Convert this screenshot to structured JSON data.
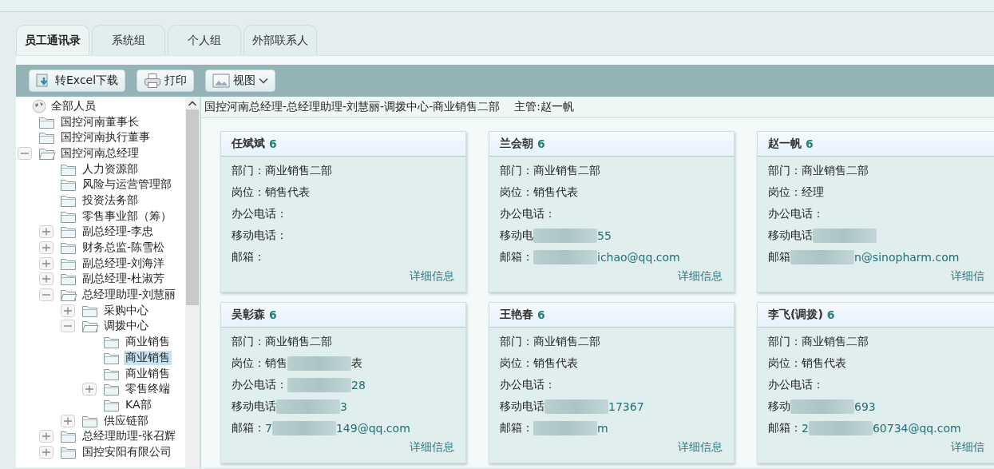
{
  "tabs": [
    {
      "label": "员工通讯录",
      "selected": true
    },
    {
      "label": "系统组",
      "selected": false
    },
    {
      "label": "个人组",
      "selected": false
    },
    {
      "label": "外部联系人",
      "selected": false
    }
  ],
  "toolbar": [
    {
      "kind": "excel",
      "label": "转Excel下载"
    },
    {
      "kind": "print",
      "label": "打印"
    },
    {
      "kind": "view",
      "label": "视图"
    }
  ],
  "tree": {
    "label": "全部人员",
    "selected": false,
    "children": [
      {
        "label": "国控河南董事长",
        "selected": false
      },
      {
        "label": "国控河南执行董事",
        "selected": false
      },
      {
        "label": "国控河南总经理",
        "selected": false,
        "expanded": true,
        "children": [
          {
            "label": "人力资源部",
            "selected": false
          },
          {
            "label": "风险与运营管理部",
            "selected": false
          },
          {
            "label": "投资法务部",
            "selected": false
          },
          {
            "label": "零售事业部（筹）",
            "selected": false
          },
          {
            "label": "副总经理-李忠",
            "selected": false,
            "expanded": false
          },
          {
            "label": "财务总监-陈雪松",
            "selected": false,
            "expanded": false
          },
          {
            "label": "副总经理-刘海洋",
            "selected": false,
            "expanded": false
          },
          {
            "label": "副总经理-杜淑芳",
            "selected": false,
            "expanded": false
          },
          {
            "label": "总经理助理-刘慧丽",
            "selected": false,
            "expanded": true,
            "children": [
              {
                "label": "采购中心",
                "selected": false,
                "expanded": false
              },
              {
                "label": "调拨中心",
                "selected": false,
                "expanded": true,
                "children": [
                  {
                    "label": "商业销售",
                    "selected": false
                  },
                  {
                    "label": "商业销售",
                    "selected": true
                  },
                  {
                    "label": "商业销售",
                    "selected": false
                  },
                  {
                    "label": "零售终端",
                    "selected": false,
                    "expanded": false
                  },
                  {
                    "label": "KA部",
                    "selected": false
                  }
                ]
              },
              {
                "label": "供应链部",
                "selected": false,
                "expanded": false
              }
            ]
          },
          {
            "label": "总经理助理-张召辉",
            "selected": false,
            "expanded": false
          },
          {
            "label": "国控安阳有限公司",
            "selected": false,
            "expanded": false
          }
        ]
      }
    ]
  },
  "breadcrumb": {
    "path": "国控河南总经理-总经理助理-刘慧丽-调拨中心-商业销售二部",
    "manager": "主管:赵一帆"
  },
  "cards": [
    {
      "name": "任斌斌",
      "count": "6",
      "link": "详细信息",
      "fields": [
        [
          {
            "kind": "label",
            "text": "部门：商业销售二部"
          }
        ],
        [
          {
            "kind": "label",
            "text": "岗位：销售代表"
          }
        ],
        [
          {
            "kind": "label",
            "text": "办公电话："
          }
        ],
        [
          {
            "kind": "label",
            "text": "移动电话："
          }
        ],
        [
          {
            "kind": "label",
            "text": "邮箱："
          }
        ]
      ]
    },
    {
      "name": "兰会朝",
      "count": "6",
      "link": "详细信息",
      "fields": [
        [
          {
            "kind": "label",
            "text": "部门：商业销售二部"
          }
        ],
        [
          {
            "kind": "label",
            "text": "岗位：销售代表"
          }
        ],
        [
          {
            "kind": "label",
            "text": "办公电话："
          }
        ],
        [
          {
            "kind": "label",
            "text": "移动电"
          },
          {
            "kind": "mask"
          },
          {
            "kind": "value",
            "text": "55"
          }
        ],
        [
          {
            "kind": "label",
            "text": "邮箱："
          },
          {
            "kind": "mask"
          },
          {
            "kind": "value",
            "text": "ichao@qq.com"
          }
        ]
      ]
    },
    {
      "name": "赵一帆",
      "count": "6",
      "link": "详细信",
      "fields": [
        [
          {
            "kind": "label",
            "text": "部门：商业销售二部"
          }
        ],
        [
          {
            "kind": "label",
            "text": "岗位：经理"
          }
        ],
        [
          {
            "kind": "label",
            "text": "办公电话："
          }
        ],
        [
          {
            "kind": "label",
            "text": "移动电话"
          },
          {
            "kind": "mask"
          }
        ],
        [
          {
            "kind": "label",
            "text": "邮箱"
          },
          {
            "kind": "mask"
          },
          {
            "kind": "value",
            "text": "n@sinopharm.com"
          }
        ]
      ]
    },
    {
      "name": "吴彰森",
      "count": "6",
      "link": "详细信息",
      "fields": [
        [
          {
            "kind": "label",
            "text": "部门：商业销售二部"
          }
        ],
        [
          {
            "kind": "label",
            "text": "岗位：销售"
          },
          {
            "kind": "mask"
          },
          {
            "kind": "label",
            "text": "表"
          }
        ],
        [
          {
            "kind": "label",
            "text": "办公电话："
          },
          {
            "kind": "mask"
          },
          {
            "kind": "value",
            "text": "28"
          }
        ],
        [
          {
            "kind": "label",
            "text": "移动电话"
          },
          {
            "kind": "mask"
          },
          {
            "kind": "value",
            "text": "3"
          }
        ],
        [
          {
            "kind": "label",
            "text": "邮箱："
          },
          {
            "kind": "value",
            "text": "7"
          },
          {
            "kind": "mask"
          },
          {
            "kind": "value",
            "text": "149@qq.com"
          }
        ]
      ]
    },
    {
      "name": "王艳春",
      "count": "6",
      "link": "详细信息",
      "fields": [
        [
          {
            "kind": "label",
            "text": "部门：商业销售二部"
          }
        ],
        [
          {
            "kind": "label",
            "text": "岗位：销售代表"
          }
        ],
        [
          {
            "kind": "label",
            "text": "办公电话："
          }
        ],
        [
          {
            "kind": "label",
            "text": "移动电话"
          },
          {
            "kind": "mask"
          },
          {
            "kind": "value",
            "text": "17367"
          }
        ],
        [
          {
            "kind": "label",
            "text": "邮箱："
          },
          {
            "kind": "mask"
          },
          {
            "kind": "value",
            "text": "m"
          }
        ]
      ]
    },
    {
      "name": "李飞(调拨)",
      "count": "6",
      "link": "详细信",
      "fields": [
        [
          {
            "kind": "label",
            "text": "部门：商业销售二部"
          }
        ],
        [
          {
            "kind": "label",
            "text": "岗位：销售代表"
          }
        ],
        [
          {
            "kind": "label",
            "text": "办公电话："
          }
        ],
        [
          {
            "kind": "label",
            "text": "移动"
          },
          {
            "kind": "mask"
          },
          {
            "kind": "value",
            "text": "693"
          }
        ],
        [
          {
            "kind": "label",
            "text": "邮箱："
          },
          {
            "kind": "value",
            "text": "2"
          },
          {
            "kind": "mask"
          },
          {
            "kind": "value",
            "text": "60734@qq.com"
          }
        ]
      ]
    }
  ]
}
